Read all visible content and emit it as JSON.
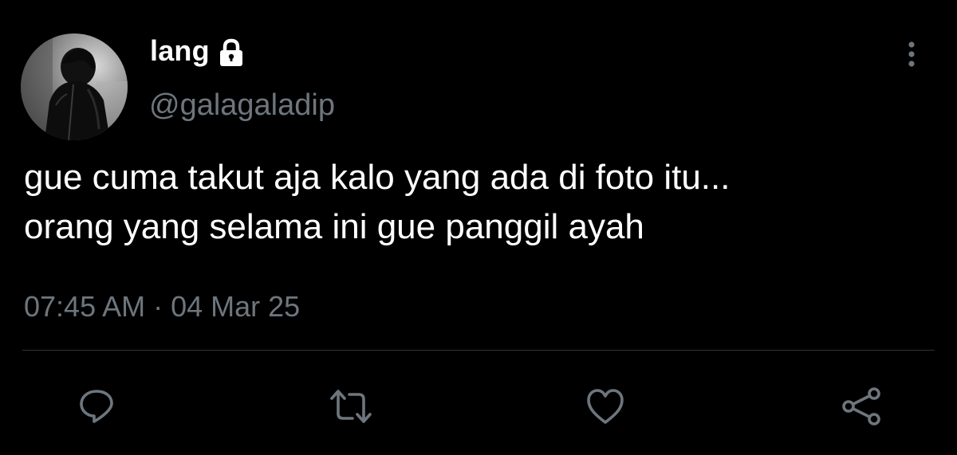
{
  "author": {
    "display_name": "lang",
    "handle": "@galagaladip",
    "verified_icon": "lock-icon",
    "avatar_icon": "profile-photo"
  },
  "tweet": {
    "lines": [
      "gue cuma takut aja kalo yang ada di foto itu...",
      "orang yang selama ini gue panggil ayah"
    ],
    "time": "07:45 AM",
    "separator": " · ",
    "date": "04 Mar 25"
  },
  "actions": {
    "reply_icon": "reply-icon",
    "retweet_icon": "retweet-icon",
    "like_icon": "heart-icon",
    "share_icon": "share-icon",
    "more_icon": "more-vertical-icon"
  },
  "colors": {
    "background": "#000000",
    "text_primary": "#ffffff",
    "text_secondary": "#6e767d",
    "divider": "#2f3336"
  }
}
